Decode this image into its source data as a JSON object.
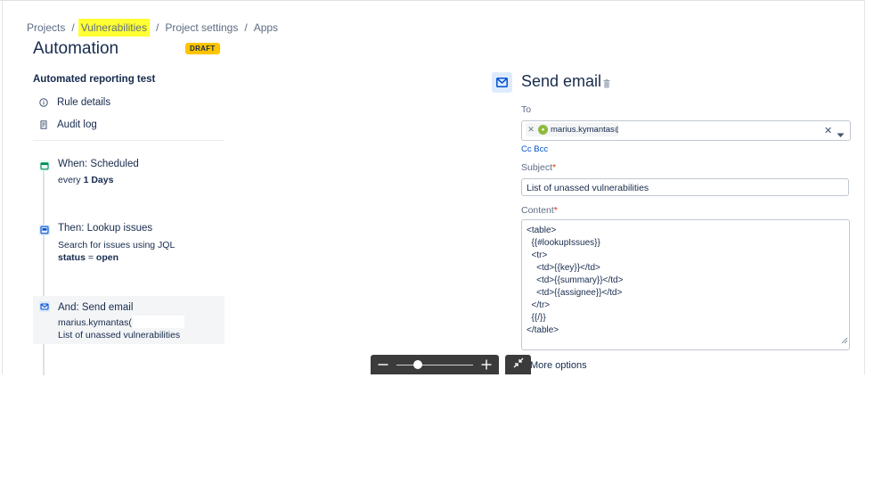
{
  "breadcrumb": {
    "items": [
      "Projects",
      "Vulnerabilities",
      "Project settings",
      "Apps"
    ],
    "separator": "/"
  },
  "page": {
    "title": "Automation",
    "status_badge": "DRAFT"
  },
  "sidebar": {
    "rule_name": "Automated reporting test",
    "nav": [
      {
        "label": "Rule details",
        "icon": "info-icon"
      },
      {
        "label": "Audit log",
        "icon": "document-icon"
      }
    ]
  },
  "steps": [
    {
      "icon": "calendar-icon",
      "title": "When: Scheduled",
      "line1_prefix": "every ",
      "line1_bold": "1 Days"
    },
    {
      "icon": "lookup-icon",
      "title": "Then: Lookup issues",
      "line1": "Search for issues using JQL",
      "line2_bold_a": "status",
      "line2_mid": " = ",
      "line2_bold_b": "open"
    },
    {
      "icon": "mail-icon",
      "title": "And: Send email",
      "line1": "marius.kymantas(",
      "line2": "List of unassed vulnerabilities"
    }
  ],
  "action": {
    "title": "Send email",
    "to_label": "To",
    "to_recipient": "marius.kymantas@",
    "cc_bcc": "Cc Bcc",
    "subject_label": "Subject",
    "subject_value": "List of unassed vulnerabilities",
    "content_label": "Content",
    "content_value": "<table>\n  {{#lookupIssues}}\n  <tr>\n    <td>{{key}}</td>\n    <td>{{summary}}</td>\n    <td>{{assignee}}</td>\n  </tr>\n  {{/}}\n</table>",
    "more_options": "More options",
    "required_mark": "*"
  },
  "colors": {
    "highlight": "#ffff33",
    "draft_badge": "#ffc400",
    "link": "#0052cc",
    "zoom_toolbar": "#3b3b3b"
  }
}
